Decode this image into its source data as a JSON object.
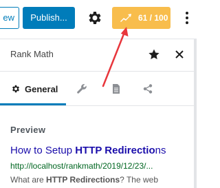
{
  "toolbar": {
    "view_label": "ew",
    "publish_label": "Publish...",
    "settings_icon": "gear-icon",
    "score": {
      "label": "61 / 100",
      "icon": "rank-math-icon",
      "color": "#f8bd4c"
    },
    "more_icon": "kebab-icon"
  },
  "panel": {
    "title": "Rank Math",
    "star_icon": "star-icon",
    "close_icon": "close-icon"
  },
  "tabs": [
    {
      "label": "General",
      "icon": "gear-icon",
      "active": true
    },
    {
      "label": "",
      "icon": "wrench-icon"
    },
    {
      "label": "",
      "icon": "document-icon"
    },
    {
      "label": "",
      "icon": "share-icon"
    }
  ],
  "preview": {
    "heading": "Preview",
    "title_prefix": "How to Setup ",
    "title_bold": "HTTP Redirectio",
    "title_suffix": "ns",
    "url": "http://localhost/rankmath/2019/12/23/...",
    "desc_prefix": "What are ",
    "desc_bold": "HTTP Redirections",
    "desc_suffix": "? The web"
  },
  "colors": {
    "primary": "#007cba",
    "score_badge": "#f8bd4c",
    "annotation_arrow": "#e8363c",
    "serp_title": "#1a0dab",
    "serp_url": "#006621"
  }
}
